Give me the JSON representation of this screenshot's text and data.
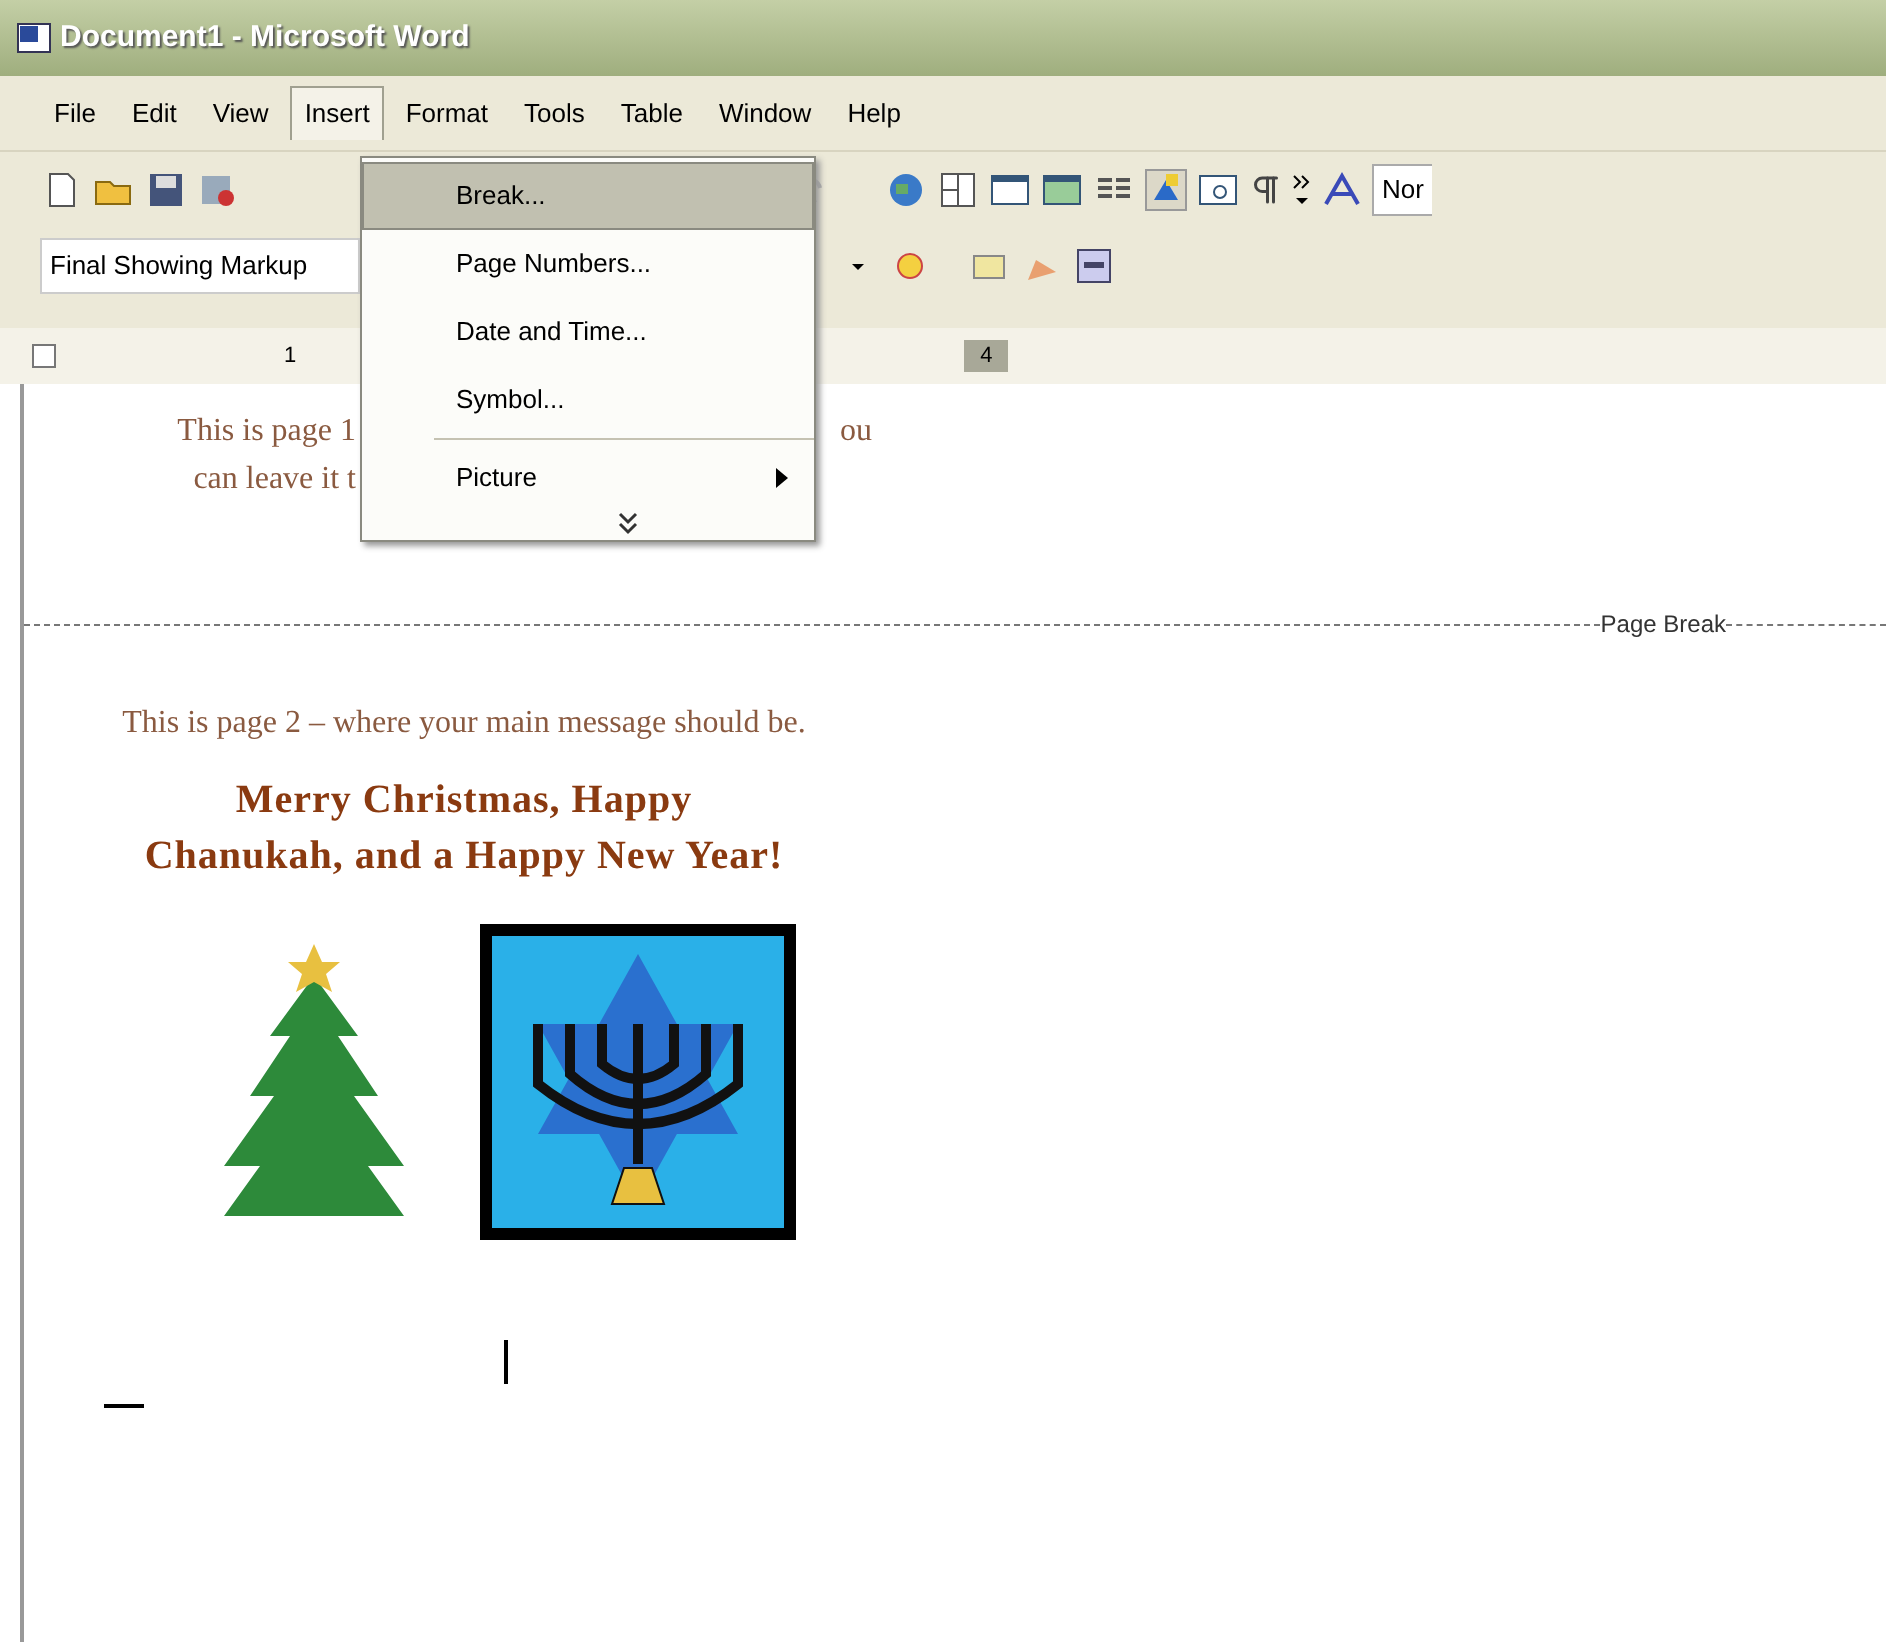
{
  "window": {
    "title": "Document1 - Microsoft Word"
  },
  "menu_bar": [
    {
      "label": "File",
      "selected": false
    },
    {
      "label": "Edit",
      "selected": false
    },
    {
      "label": "View",
      "selected": false
    },
    {
      "label": "Insert",
      "selected": true
    },
    {
      "label": "Format",
      "selected": false
    },
    {
      "label": "Tools",
      "selected": false
    },
    {
      "label": "Table",
      "selected": false
    },
    {
      "label": "Window",
      "selected": false
    },
    {
      "label": "Help",
      "selected": false
    }
  ],
  "insert_menu": {
    "items": [
      {
        "label": "Break...",
        "selected": true,
        "submenu": false
      },
      {
        "label": "Page Numbers...",
        "selected": false,
        "submenu": false
      },
      {
        "label": "Date and Time...",
        "selected": false,
        "submenu": false
      },
      {
        "label": "Symbol...",
        "selected": false,
        "submenu": false
      },
      {
        "label": "Picture",
        "selected": false,
        "submenu": true
      }
    ]
  },
  "toolbar": {
    "display_mode": "Final Showing Markup",
    "style_box": "Nor"
  },
  "ruler": {
    "number_1": "1",
    "number_4": "4"
  },
  "document": {
    "page1_left_lines": [
      "This is page 1",
      "can leave it t"
    ],
    "page1_right_fragment": "ou",
    "page_break_label": "Page Break",
    "page2_text": "This is page 2 – where your main message should be.",
    "greeting": "Merry Christmas, Happy Chanukah, and a Happy New Year!"
  }
}
